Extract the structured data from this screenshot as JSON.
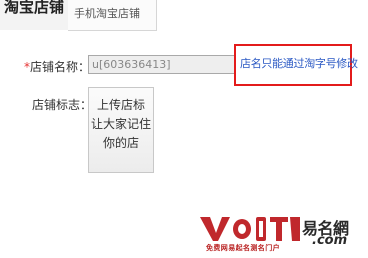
{
  "tabs": [
    {
      "label": "淘宝店铺",
      "active": true
    },
    {
      "label": "手机淘宝店铺",
      "active": false
    }
  ],
  "form": {
    "shop_name": {
      "required_mark": "*",
      "label": "店铺名称：",
      "value": "u[603636413]"
    },
    "hint": "店名只能通过淘字号修改",
    "shop_logo": {
      "label": "店铺标志：",
      "upload_lines": [
        "上传店标",
        "让大家记住",
        "你的店"
      ]
    }
  },
  "watermark": {
    "brand": "易名網",
    "domain": ".com",
    "slogan": "免费网易起名测名门户"
  },
  "colors": {
    "required": "#e53333",
    "hint_text": "#2b59c4",
    "hint_border": "#e31b1b",
    "watermark_red": "#c0282c"
  }
}
